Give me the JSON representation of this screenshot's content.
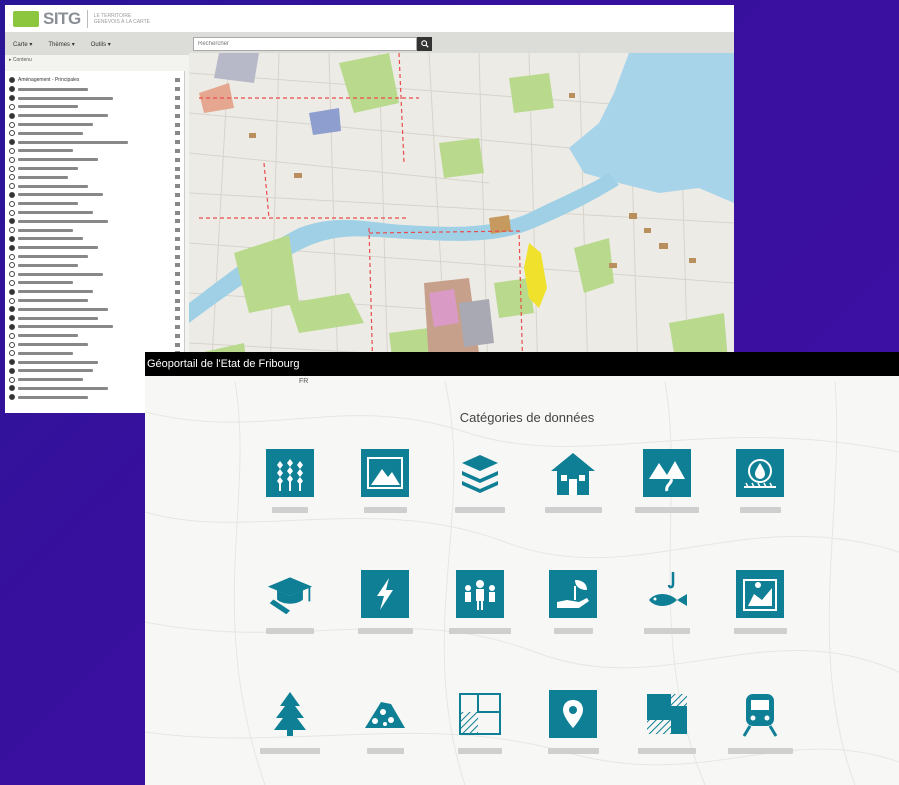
{
  "sitg": {
    "logo": "SITG",
    "tagline": "LE TERRITOIRE GENEVOIS À LA CARTE",
    "menus": [
      "Carte",
      "Thèmes",
      "Outils"
    ],
    "search": {
      "placeholder": "Rechercher",
      "button_icon": "search-icon"
    },
    "subbar_label": "Contenu",
    "panel_title": "Aménagement - Principales",
    "layers": [
      {
        "on": true
      },
      {
        "on": true
      },
      {
        "on": false
      },
      {
        "on": true
      },
      {
        "on": false
      },
      {
        "on": false
      },
      {
        "on": true
      },
      {
        "on": false
      },
      {
        "on": false
      },
      {
        "on": false
      },
      {
        "on": false
      },
      {
        "on": false
      },
      {
        "on": true
      },
      {
        "on": false
      },
      {
        "on": false
      },
      {
        "on": true
      },
      {
        "on": false
      },
      {
        "on": true
      },
      {
        "on": true
      },
      {
        "on": false
      },
      {
        "on": false
      },
      {
        "on": false
      },
      {
        "on": false
      },
      {
        "on": true
      },
      {
        "on": false
      },
      {
        "on": true
      },
      {
        "on": true
      },
      {
        "on": true
      },
      {
        "on": false
      },
      {
        "on": false
      },
      {
        "on": false
      },
      {
        "on": true
      },
      {
        "on": true
      },
      {
        "on": false
      },
      {
        "on": true
      },
      {
        "on": true
      }
    ]
  },
  "fribourg": {
    "title": "Géoportail de l'Etat de Fribourg",
    "lang": "FR",
    "heading": "Catégories de données",
    "accent": "#0e7f94"
  }
}
